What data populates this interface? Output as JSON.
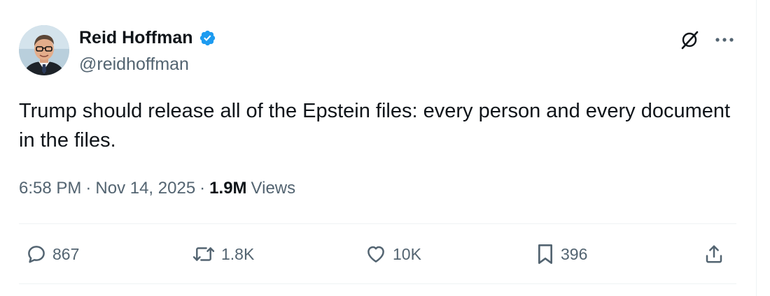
{
  "author": {
    "name": "Reid Hoffman",
    "handle": "@reidhoffman",
    "verified": true
  },
  "tweet": {
    "text": "Trump should release all of the Epstein files: every person and every document in the files.",
    "time": "6:58 PM",
    "date": "Nov 14, 2025",
    "views_count": "1.9M",
    "views_label": "Views",
    "separator": "·"
  },
  "actions": {
    "replies": "867",
    "reposts": "1.8K",
    "likes": "10K",
    "bookmarks": "396"
  },
  "icons": {
    "verified": "verified-badge-icon",
    "grok": "grok-icon",
    "more": "more-icon",
    "reply": "reply-icon",
    "repost": "repost-icon",
    "like": "like-icon",
    "bookmark": "bookmark-icon",
    "share": "share-icon"
  },
  "colors": {
    "text_primary": "#0f1419",
    "text_secondary": "#536471",
    "verified_blue": "#1d9bf0",
    "divider": "#eff3f4"
  }
}
